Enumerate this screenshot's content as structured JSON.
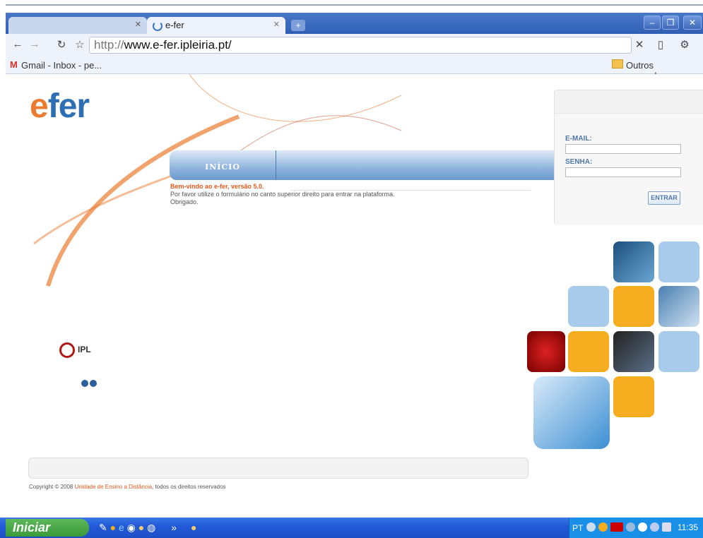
{
  "browser": {
    "tabs": [
      {
        "label": ""
      },
      {
        "label": "e-fer"
      }
    ],
    "url_scheme": "http://",
    "url_host": "www.e-fer.ipleiria.pt/",
    "bookmarks": [
      {
        "label": "Gmail - Inbox - pe..."
      }
    ],
    "other_bookmarks": "Outros marcadores"
  },
  "page": {
    "logo_e": "e",
    "logo_rest": "fer",
    "nav": {
      "home_label": "INÍCIO"
    },
    "welcome_title": "Bem-vindo ao e-fer, versão 5.0.",
    "welcome_line1": "Por favor utilize o formulário no canto superior direito para entrar na plataforma.",
    "welcome_line2": "Obrigado.",
    "login": {
      "email_label": "E-MAIL:",
      "password_label": "SENHA:",
      "submit_label": "ENTRAR"
    },
    "ipl_label": "IPL",
    "footer": {
      "copyright_prefix": "Copyright © 2008 ",
      "copyright_link": "Unidade de Ensino a Distância",
      "copyright_suffix": ", todos os direitos reservados"
    }
  },
  "taskbar": {
    "start_label": "Iniciar",
    "language": "PT",
    "clock": "11:35"
  },
  "colors": {
    "accent_orange": "#e8581c",
    "brand_blue": "#2e6fb4",
    "tile_orange": "#f7ad20",
    "tile_blue": "#a9cbeb"
  }
}
